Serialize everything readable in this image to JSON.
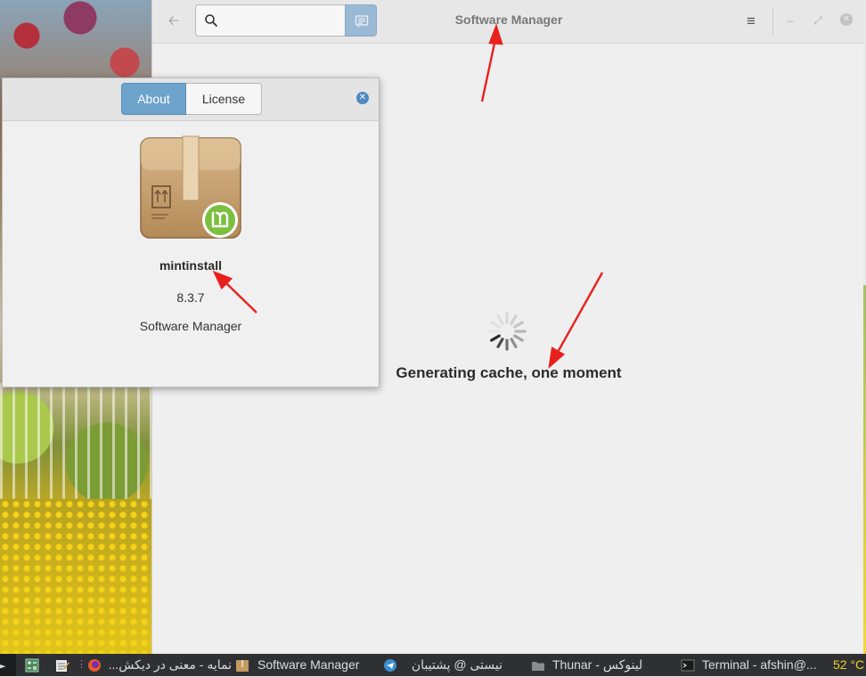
{
  "window": {
    "title": "Software Manager",
    "search": {
      "value": "",
      "placeholder": ""
    },
    "status_message": "Generating cache, one moment"
  },
  "about_dialog": {
    "tabs": [
      {
        "label": "About",
        "active": true
      },
      {
        "label": "License",
        "active": false
      }
    ],
    "app_name": "mintinstall",
    "version": "8.3.7",
    "description": "Software Manager"
  },
  "taskbar": {
    "items": [
      {
        "label": "نمایه - معنی در دیکش..."
      },
      {
        "label": "Software Manager"
      },
      {
        "label": "نیستی @ پشتیبان"
      },
      {
        "label": "Thunar - لینوکس"
      },
      {
        "label": "Terminal - afshin@..."
      }
    ],
    "temperature": "52 °C"
  },
  "colors": {
    "accent": "#6ea3cc",
    "annotation_arrow": "#e8211d",
    "taskbar_bg": "#2e3033",
    "temperature": "#f1d22c"
  },
  "icons": {
    "back": "arrow-left-icon",
    "search": "search-icon",
    "subsearch": "subsearch-toggle-icon",
    "menu": "hamburger-menu-icon",
    "minimize": "minimize-icon",
    "maximize": "maximize-icon",
    "close": "close-icon",
    "app": "package-box-icon",
    "spinner": "loading-spinner-icon"
  }
}
